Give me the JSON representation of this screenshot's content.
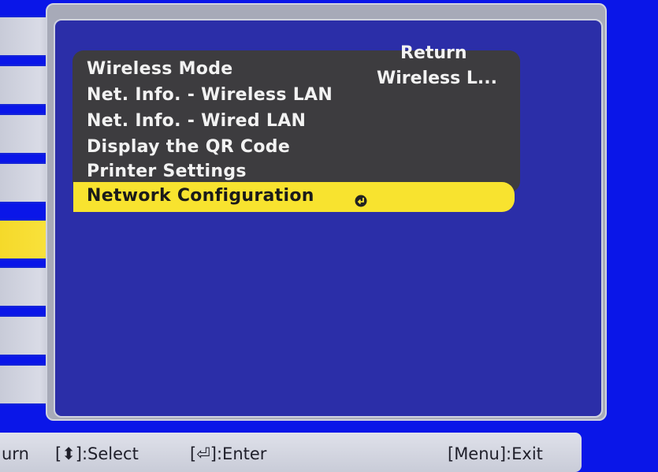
{
  "menu": {
    "return_label": "Return",
    "items": [
      {
        "label": "Wireless Mode",
        "value": "Wireless L..."
      },
      {
        "label": "Net. Info. - Wireless LAN"
      },
      {
        "label": "Net. Info. - Wired LAN"
      },
      {
        "label": "Display the QR Code"
      },
      {
        "label": "Printer Settings"
      },
      {
        "label": "Network Configuration",
        "selected": true,
        "icon": "enter-icon"
      }
    ]
  },
  "status_bar": {
    "left_fragment": "urn",
    "select_hint": "[⬍]:Select",
    "enter_hint": "[⏎]:Enter",
    "exit_hint": "[Menu]:Exit"
  },
  "colors": {
    "background": "#0a16e8",
    "panel": "#2b2ea8",
    "highlight": "#f8e32f",
    "menu_bg": "#3d3c3f"
  }
}
